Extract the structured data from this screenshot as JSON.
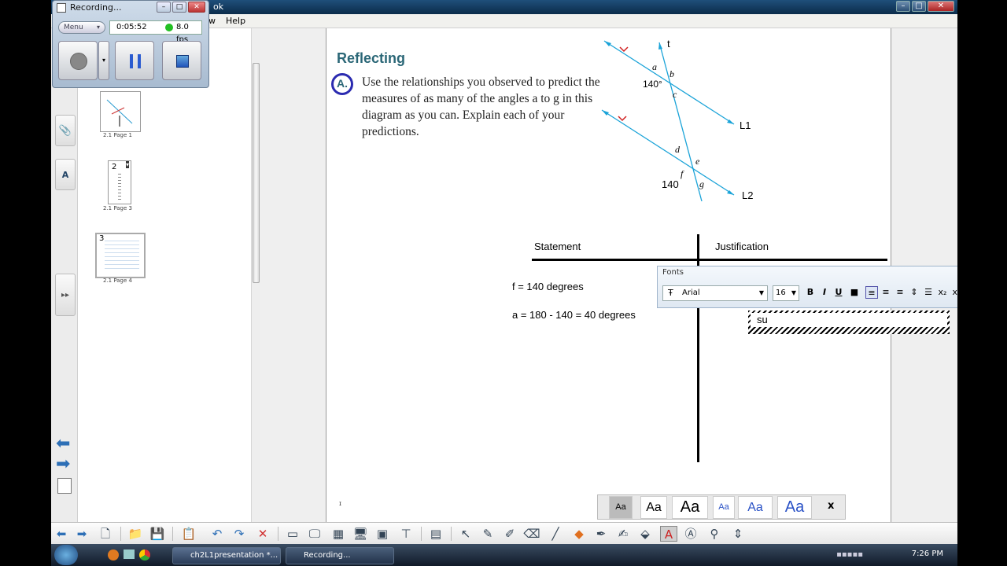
{
  "app": {
    "title_fragment": "ok"
  },
  "menu": {
    "items": [
      "w",
      "Help"
    ]
  },
  "recorder": {
    "title": "Recording...",
    "menu_label": "Menu",
    "elapsed": "0:05:52",
    "fps": "8.0 fps",
    "status_color": "#22c022"
  },
  "sorter": {
    "pages": [
      {
        "number": "",
        "label": "2.1 Page 1"
      },
      {
        "number": "2",
        "label": "2.1 Page 3"
      },
      {
        "number": "3",
        "label": "2.1 Page 4"
      }
    ]
  },
  "page": {
    "heading": "Reflecting",
    "part_label": "A.",
    "prompt": "Use the relationships you observed to predict the measures of as many of the angles a to g in this diagram as you can. Explain each of your predictions.",
    "diagram": {
      "transversal_label": "t",
      "line1_label": "L1",
      "line2_label": "L2",
      "angle_top": "140°",
      "angle_bottom": "140",
      "letters": [
        "a",
        "b",
        "c",
        "d",
        "e",
        "f",
        "g"
      ]
    },
    "table": {
      "statement_header": "Statement",
      "justification_header": "Justification",
      "rows": [
        "f = 140 degrees",
        "a = 180 - 140 = 40 degrees"
      ]
    },
    "tiny_mark": "ɪ"
  },
  "text_input": {
    "value": "su"
  },
  "fonts_toolbar": {
    "title": "Fonts",
    "font": "Arial",
    "size": "16",
    "close_label": "x",
    "buttons": [
      "B",
      "I",
      "U",
      "■"
    ]
  },
  "font_styles": {
    "samples": [
      "Aa",
      "Aa",
      "Aa",
      "Aa",
      "Aa",
      "Aa"
    ],
    "close_label": "x"
  },
  "taskbar": {
    "tasks": [
      "ch2L1presentation *...",
      "Recording..."
    ],
    "clock": "7:26 PM"
  },
  "colors": {
    "accent_teal": "#2b6777",
    "diagram_cyan": "#1aa3d8",
    "circle_blue": "#2b2bb0",
    "diagram_red": "#d02020"
  }
}
